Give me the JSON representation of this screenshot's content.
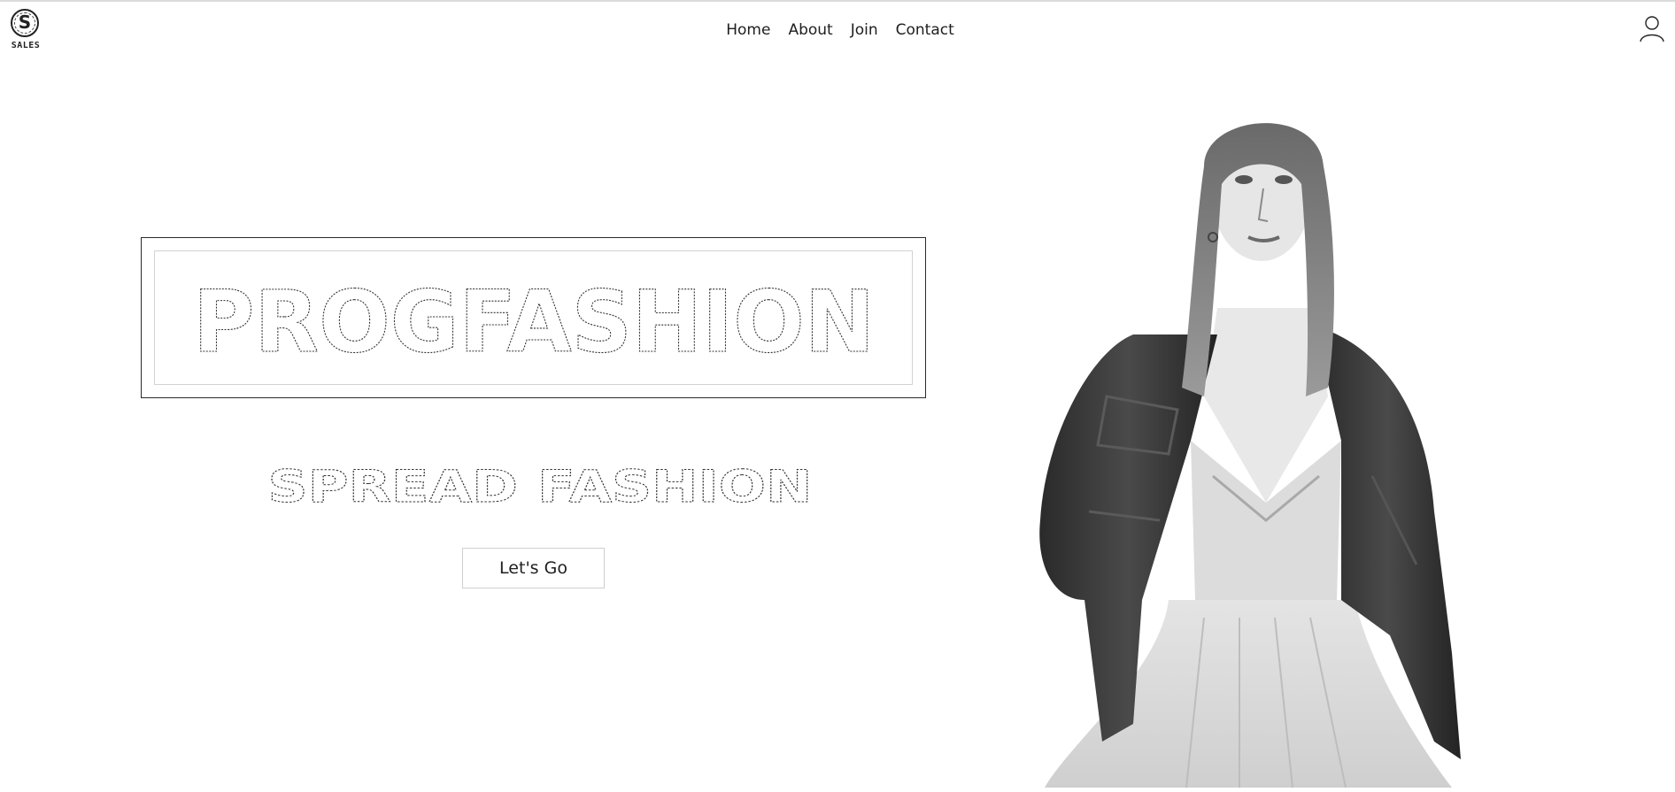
{
  "header": {
    "logo": {
      "mark": "S",
      "brand": "SALES"
    },
    "nav": [
      {
        "label": "Home"
      },
      {
        "label": "About"
      },
      {
        "label": "Join"
      },
      {
        "label": "Contact"
      }
    ],
    "user_icon": "user-icon"
  },
  "hero": {
    "title": "PROGFASHION",
    "subtitle": "SPREAD FASHION",
    "cta_label": "Let's Go"
  },
  "image": {
    "subject": "model-photo",
    "style": "black-and-white"
  },
  "colors": {
    "background": "#ffffff",
    "text": "#1e1e1e",
    "outline": "#2a2a2a",
    "light_outline": "#cfcfcf"
  }
}
